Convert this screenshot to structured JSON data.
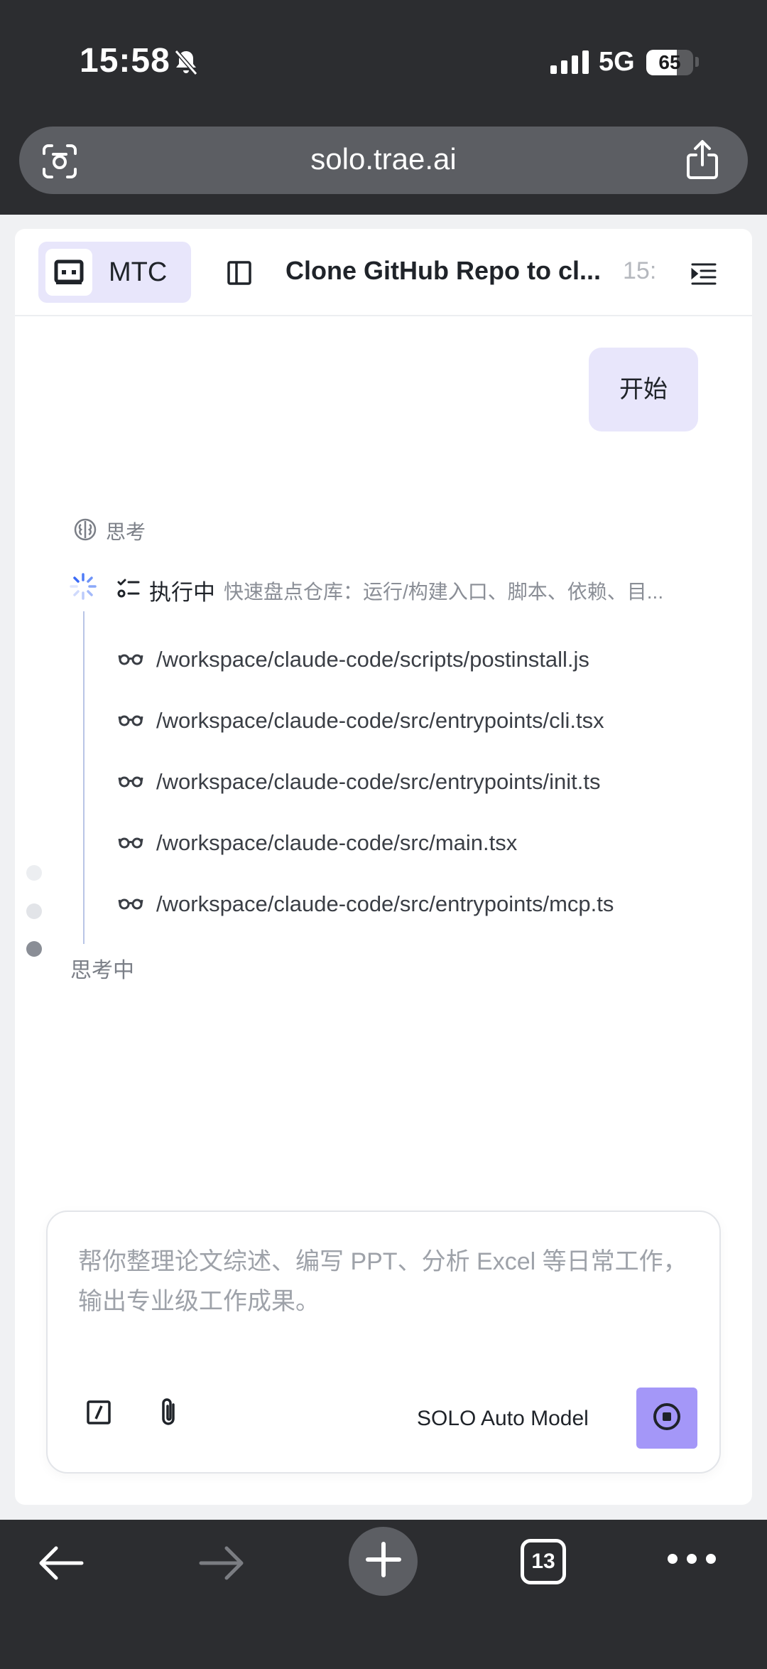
{
  "status_bar": {
    "time": "15:58",
    "network": "5G",
    "battery": "65",
    "battery_level": 0.65
  },
  "browser": {
    "url": "solo.trae.ai",
    "tab_count": "13"
  },
  "header": {
    "workspace_label": "MTC",
    "conversation_title": "Clone GitHub Repo to cl...",
    "conversation_time": "15:"
  },
  "chat": {
    "user_message": "开始",
    "thinking_label": "思考",
    "executing": {
      "status": "执行中",
      "description": "快速盘点仓库：运行/构建入口、脚本、依赖、目..."
    },
    "files": [
      "/workspace/claude-code/scripts/postinstall.js",
      "/workspace/claude-code/src/entrypoints/cli.tsx",
      "/workspace/claude-code/src/entrypoints/init.ts",
      "/workspace/claude-code/src/main.tsx",
      "/workspace/claude-code/src/entrypoints/mcp.ts"
    ],
    "thinking_status": "思考中"
  },
  "composer": {
    "placeholder": "帮你整理论文综述、编写 PPT、分析 Excel 等日常工作，输出专业级工作成果。",
    "model": "SOLO Auto Model"
  },
  "colors": {
    "accent": "#a497f8",
    "accent_light": "#e8e6fb",
    "chrome_dark": "#2c2d30",
    "url_bar": "#5c5e63"
  },
  "icons": {
    "scan": "scan-icon",
    "share": "share-icon",
    "panel": "panel-icon",
    "outline": "outline-icon",
    "thinking": "brain-icon",
    "spinner": "spinner-icon",
    "task": "checklist-icon",
    "read": "glasses-icon",
    "slash": "slash-command-icon",
    "attach": "paperclip-icon",
    "stop": "stop-icon"
  }
}
